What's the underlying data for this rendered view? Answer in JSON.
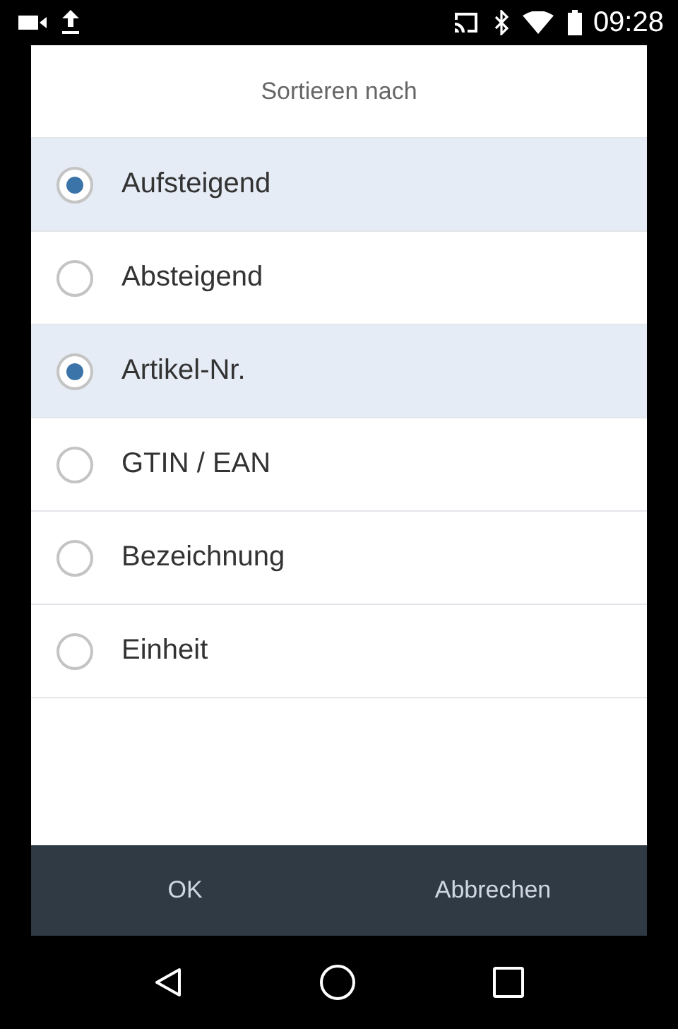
{
  "status_bar": {
    "time": "09:28"
  },
  "dialog": {
    "title": "Sortieren nach",
    "order_options": [
      {
        "label": "Aufsteigend",
        "selected": true
      },
      {
        "label": "Absteigend",
        "selected": false
      }
    ],
    "field_options": [
      {
        "label": "Artikel-Nr.",
        "selected": true
      },
      {
        "label": "GTIN / EAN",
        "selected": false
      },
      {
        "label": "Bezeichnung",
        "selected": false
      },
      {
        "label": "Einheit",
        "selected": false
      }
    ],
    "buttons": [
      "OK",
      "Abbrechen"
    ]
  }
}
